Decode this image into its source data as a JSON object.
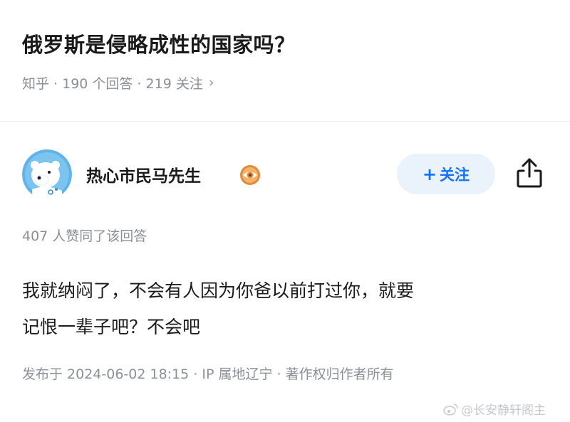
{
  "question": {
    "title": "俄罗斯是侵略成性的国家吗？",
    "meta": "知乎 · 190 个回答 · 219 关注",
    "chevron": "›"
  },
  "author": {
    "name": "热心市民马先生",
    "avatar_icon": "polar-bear-avatar",
    "badge_icon": "eye-badge-icon"
  },
  "actions": {
    "follow_plus": "+",
    "follow_label": "关注",
    "share_icon": "share-icon"
  },
  "answer": {
    "votes": "407 人赞同了该回答",
    "lines": [
      "我就纳闷了，不会有人因为你爸以前打过你，就要",
      "记恨一辈子吧？不会吧"
    ],
    "publish_info": "发布于 2024-06-02 18:15 · IP 属地辽宁 · 著作权归作者所有"
  },
  "watermark": {
    "text": "@长安静轩阁主"
  },
  "colors": {
    "accent": "#1772f6",
    "follow_bg": "#eaf2fc",
    "text_primary": "#1a1a1a",
    "text_secondary": "#8a8f99",
    "avatar_bg": "#5fb3e8",
    "badge": "#e08a3c"
  }
}
